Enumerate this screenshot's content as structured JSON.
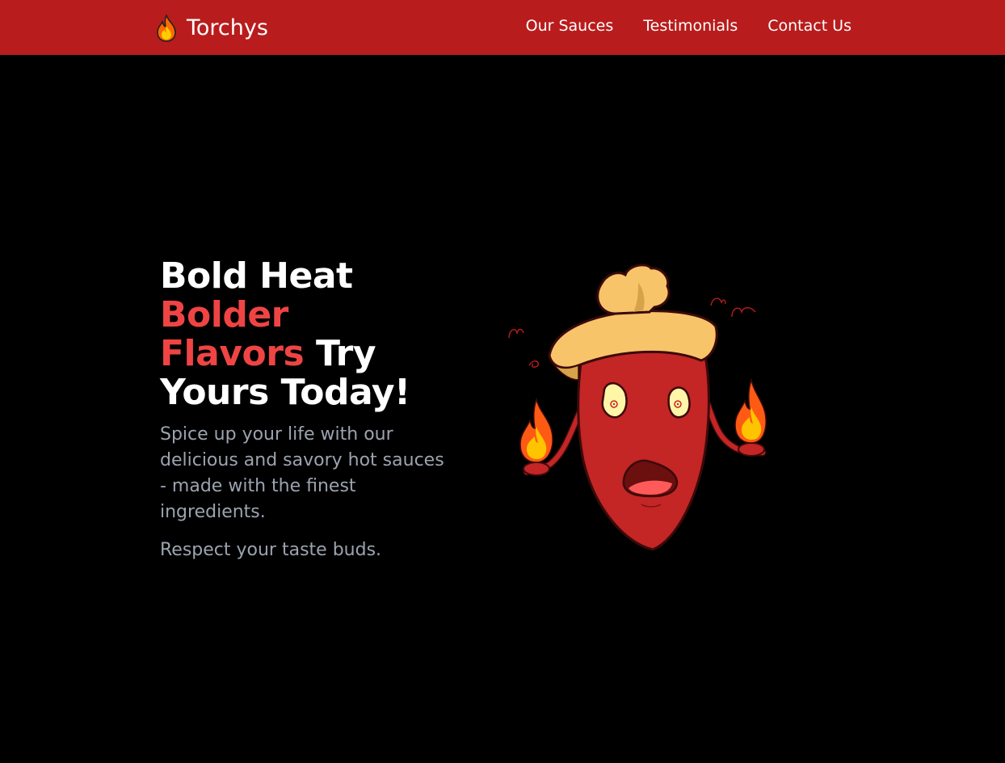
{
  "brand": {
    "name": "Torchys",
    "icon": "flame-icon"
  },
  "nav": {
    "links": [
      "Our Sauces",
      "Testimonials",
      "Contact Us"
    ]
  },
  "hero": {
    "headline": {
      "line1": "Bold Heat",
      "accent1": "Bolder",
      "accent2": "Flavors",
      "rest2": "Try",
      "line4": "Yours Today!"
    },
    "lead": "Spice up your life with our delicious and savory hot sauces - made with the finest ingredients.",
    "tagline": "Respect your taste buds.",
    "image_icon": "chili-pepper-chef-mascot"
  },
  "colors": {
    "nav_bg": "#b91c1c",
    "page_bg": "#000000",
    "accent_red": "#ef4444",
    "muted_text": "#9ca3af"
  }
}
